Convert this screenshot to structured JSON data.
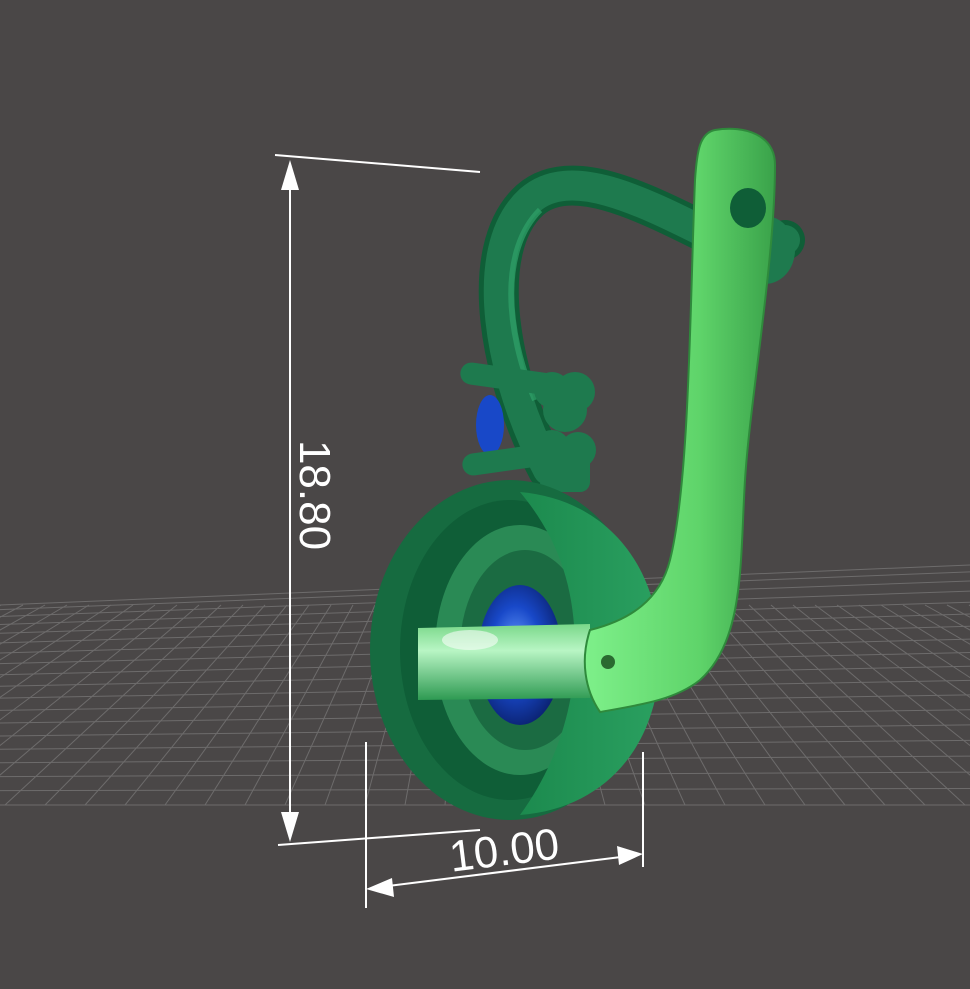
{
  "viewport": {
    "background": "#4a4747",
    "grid_color": "#8a8a8a"
  },
  "dimensions": {
    "height_label": "18.80",
    "width_label": "10.00",
    "line_color": "#ffffff"
  },
  "model": {
    "colors": {
      "hook": "#1e7a4e",
      "lever": "#5fd46a",
      "bezel": "#1f8a50",
      "bezel_dark": "#0f5e37",
      "gem": "#1848c8"
    }
  }
}
